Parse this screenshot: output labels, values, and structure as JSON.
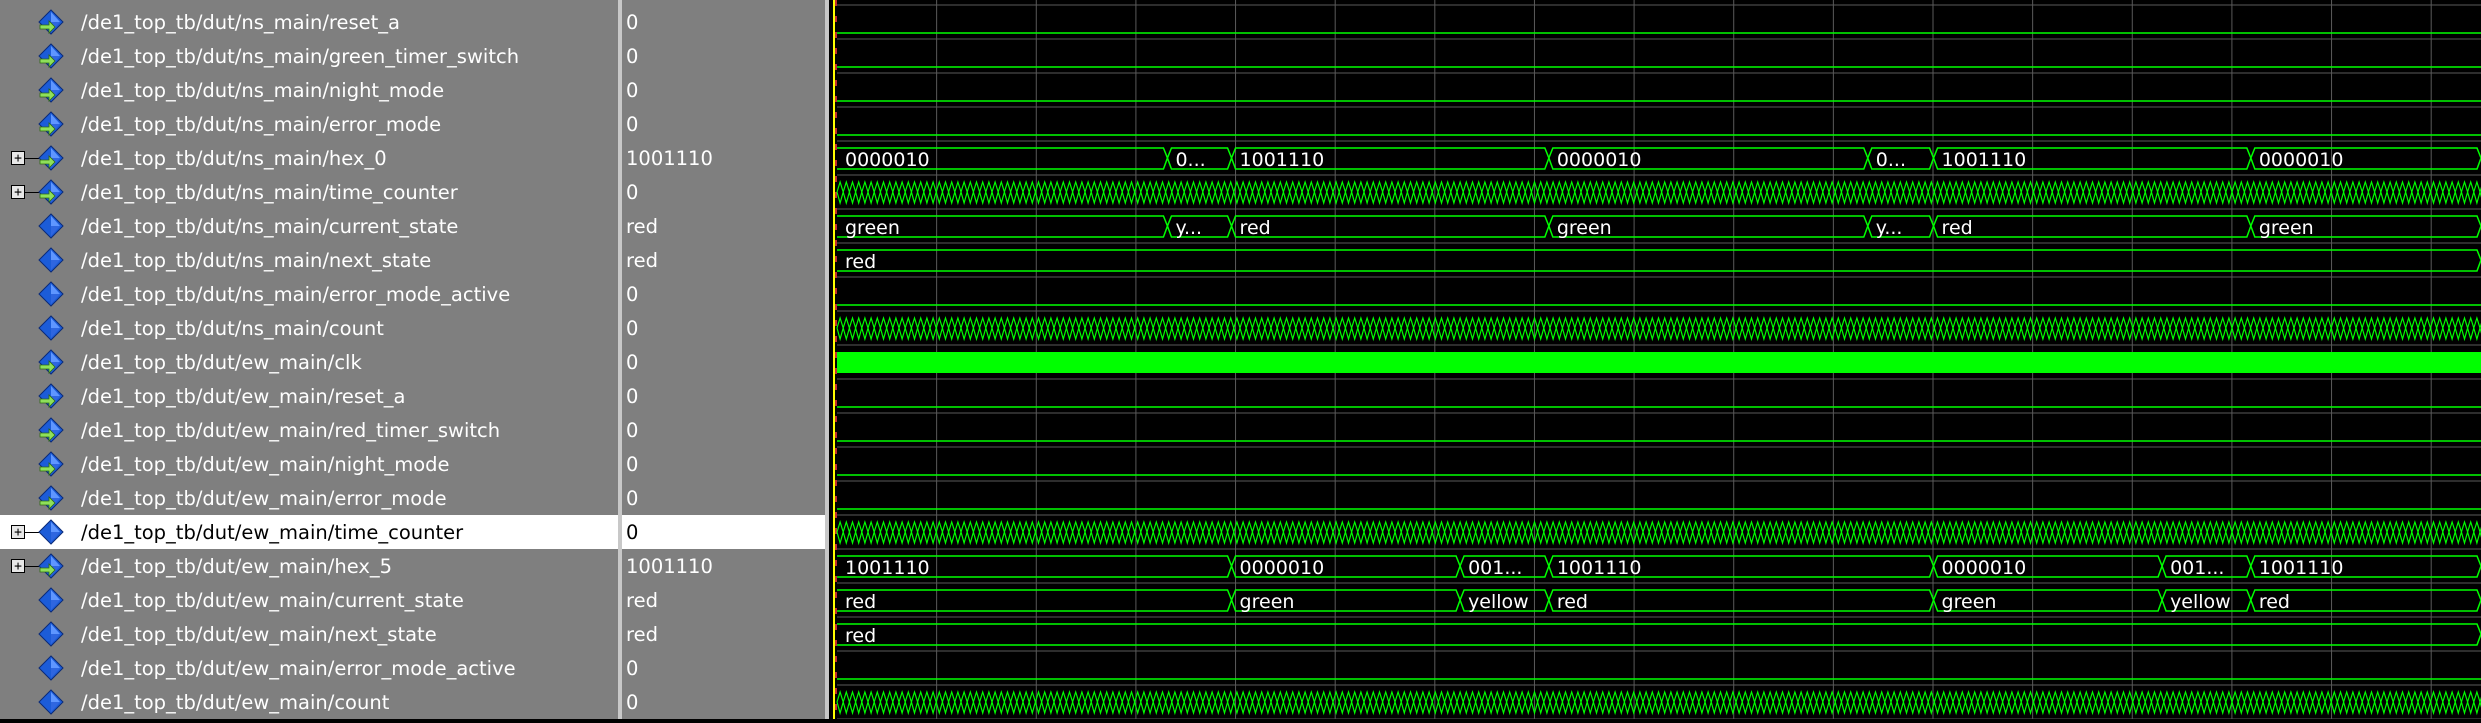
{
  "signals": [
    {
      "name": "/de1_top_tb/dut/ns_main/reset_a",
      "value": "0",
      "icon": "input-port-icon"
    },
    {
      "name": "/de1_top_tb/dut/ns_main/green_timer_switch",
      "value": "0",
      "icon": "input-port-icon"
    },
    {
      "name": "/de1_top_tb/dut/ns_main/night_mode",
      "value": "0",
      "icon": "input-port-icon"
    },
    {
      "name": "/de1_top_tb/dut/ns_main/error_mode",
      "value": "0",
      "icon": "input-port-icon"
    },
    {
      "name": "/de1_top_tb/dut/ns_main/hex_0",
      "value": "1001110",
      "icon": "output-port-icon",
      "expandable": true
    },
    {
      "name": "/de1_top_tb/dut/ns_main/time_counter",
      "value": "0",
      "icon": "output-port-icon",
      "expandable": true
    },
    {
      "name": "/de1_top_tb/dut/ns_main/current_state",
      "value": "red",
      "icon": "internal-signal-icon"
    },
    {
      "name": "/de1_top_tb/dut/ns_main/next_state",
      "value": "red",
      "icon": "internal-signal-icon"
    },
    {
      "name": "/de1_top_tb/dut/ns_main/error_mode_active",
      "value": "0",
      "icon": "internal-signal-icon"
    },
    {
      "name": "/de1_top_tb/dut/ns_main/count",
      "value": "0",
      "icon": "internal-signal-icon"
    },
    {
      "name": "/de1_top_tb/dut/ew_main/clk",
      "value": "0",
      "icon": "input-port-icon"
    },
    {
      "name": "/de1_top_tb/dut/ew_main/reset_a",
      "value": "0",
      "icon": "input-port-icon"
    },
    {
      "name": "/de1_top_tb/dut/ew_main/red_timer_switch",
      "value": "0",
      "icon": "input-port-icon"
    },
    {
      "name": "/de1_top_tb/dut/ew_main/night_mode",
      "value": "0",
      "icon": "input-port-icon"
    },
    {
      "name": "/de1_top_tb/dut/ew_main/error_mode",
      "value": "0",
      "icon": "input-port-icon"
    },
    {
      "name": "/de1_top_tb/dut/ew_main/time_counter",
      "value": "0",
      "icon": "internal-signal-icon",
      "expandable": true,
      "selected": true
    },
    {
      "name": "/de1_top_tb/dut/ew_main/hex_5",
      "value": "1001110",
      "icon": "output-port-icon",
      "expandable": true
    },
    {
      "name": "/de1_top_tb/dut/ew_main/current_state",
      "value": "red",
      "icon": "internal-signal-icon"
    },
    {
      "name": "/de1_top_tb/dut/ew_main/next_state",
      "value": "red",
      "icon": "internal-signal-icon"
    },
    {
      "name": "/de1_top_tb/dut/ew_main/error_mode_active",
      "value": "0",
      "icon": "internal-signal-icon"
    },
    {
      "name": "/de1_top_tb/dut/ew_main/count",
      "value": "0",
      "icon": "internal-signal-icon"
    }
  ],
  "expand_glyph": "+",
  "waveforms": [
    {
      "kind": "low"
    },
    {
      "kind": "low"
    },
    {
      "kind": "low"
    },
    {
      "kind": "low"
    },
    {
      "kind": "bus",
      "segments": [
        {
          "label": "0000010",
          "start": 0,
          "end": 0.201
        },
        {
          "label": "0...",
          "start": 0.201,
          "end": 0.24
        },
        {
          "label": "1001110",
          "start": 0.24,
          "end": 0.433
        },
        {
          "label": "0000010",
          "start": 0.433,
          "end": 0.627
        },
        {
          "label": "0...",
          "start": 0.627,
          "end": 0.667
        },
        {
          "label": "1001110",
          "start": 0.667,
          "end": 0.86
        },
        {
          "label": "0000010",
          "start": 0.86,
          "end": 1.0
        }
      ]
    },
    {
      "kind": "dense"
    },
    {
      "kind": "bus",
      "segments": [
        {
          "label": "green",
          "start": 0,
          "end": 0.201
        },
        {
          "label": "y...",
          "start": 0.201,
          "end": 0.24
        },
        {
          "label": "red",
          "start": 0.24,
          "end": 0.433
        },
        {
          "label": "green",
          "start": 0.433,
          "end": 0.627
        },
        {
          "label": "y...",
          "start": 0.627,
          "end": 0.667
        },
        {
          "label": "red",
          "start": 0.667,
          "end": 0.86
        },
        {
          "label": "green",
          "start": 0.86,
          "end": 1.0
        }
      ]
    },
    {
      "kind": "bus",
      "segments": [
        {
          "label": "red",
          "start": 0,
          "end": 1.0
        }
      ]
    },
    {
      "kind": "low"
    },
    {
      "kind": "dense"
    },
    {
      "kind": "clock"
    },
    {
      "kind": "low"
    },
    {
      "kind": "low"
    },
    {
      "kind": "low"
    },
    {
      "kind": "low"
    },
    {
      "kind": "dense"
    },
    {
      "kind": "bus",
      "segments": [
        {
          "label": "1001110",
          "start": 0,
          "end": 0.24
        },
        {
          "label": "0000010",
          "start": 0.24,
          "end": 0.379
        },
        {
          "label": "001...",
          "start": 0.379,
          "end": 0.433
        },
        {
          "label": "1001110",
          "start": 0.433,
          "end": 0.667
        },
        {
          "label": "0000010",
          "start": 0.667,
          "end": 0.806
        },
        {
          "label": "001...",
          "start": 0.806,
          "end": 0.86
        },
        {
          "label": "1001110",
          "start": 0.86,
          "end": 1.0
        }
      ]
    },
    {
      "kind": "bus",
      "segments": [
        {
          "label": "red",
          "start": 0,
          "end": 0.24
        },
        {
          "label": "green",
          "start": 0.24,
          "end": 0.379
        },
        {
          "label": "yellow",
          "start": 0.379,
          "end": 0.433
        },
        {
          "label": "red",
          "start": 0.433,
          "end": 0.667
        },
        {
          "label": "green",
          "start": 0.667,
          "end": 0.806
        },
        {
          "label": "yellow",
          "start": 0.806,
          "end": 0.86
        },
        {
          "label": "red",
          "start": 0.86,
          "end": 1.0
        }
      ]
    },
    {
      "kind": "bus",
      "segments": [
        {
          "label": "red",
          "start": 0,
          "end": 1.0
        }
      ]
    },
    {
      "kind": "low"
    },
    {
      "kind": "dense"
    }
  ],
  "colors": {
    "trace": "#00ff00",
    "grid": "#5a5a5a",
    "cursor": "#ffff00",
    "pane_bg": "#7f7f7f",
    "wave_bg": "#000000",
    "selected_bg": "#ffffff"
  }
}
